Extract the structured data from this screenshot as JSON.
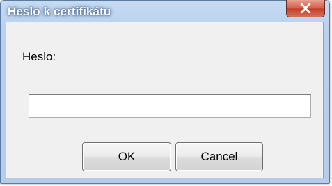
{
  "window": {
    "title": "Heslo k certifikátu",
    "close_icon": "close-x-icon"
  },
  "form": {
    "password_label": "Heslo:",
    "password_value": "",
    "password_placeholder": ""
  },
  "buttons": {
    "ok_label": "OK",
    "cancel_label": "Cancel"
  },
  "colors": {
    "title_bar": "#b9d1ee",
    "close_button": "#c43f28",
    "client_background": "#f0f0f0"
  }
}
